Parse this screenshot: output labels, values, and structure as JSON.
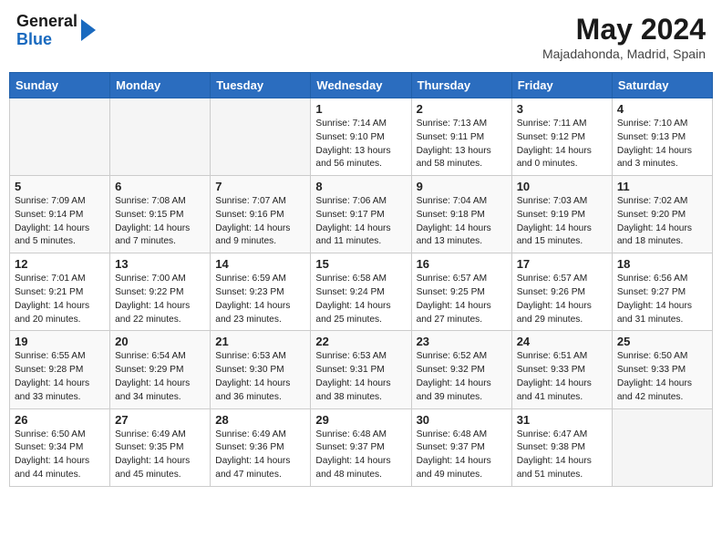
{
  "header": {
    "logo_general": "General",
    "logo_blue": "Blue",
    "month_title": "May 2024",
    "location": "Majadahonda, Madrid, Spain"
  },
  "days_of_week": [
    "Sunday",
    "Monday",
    "Tuesday",
    "Wednesday",
    "Thursday",
    "Friday",
    "Saturday"
  ],
  "weeks": [
    [
      {
        "day": "",
        "info": ""
      },
      {
        "day": "",
        "info": ""
      },
      {
        "day": "",
        "info": ""
      },
      {
        "day": "1",
        "info": "Sunrise: 7:14 AM\nSunset: 9:10 PM\nDaylight: 13 hours\nand 56 minutes."
      },
      {
        "day": "2",
        "info": "Sunrise: 7:13 AM\nSunset: 9:11 PM\nDaylight: 13 hours\nand 58 minutes."
      },
      {
        "day": "3",
        "info": "Sunrise: 7:11 AM\nSunset: 9:12 PM\nDaylight: 14 hours\nand 0 minutes."
      },
      {
        "day": "4",
        "info": "Sunrise: 7:10 AM\nSunset: 9:13 PM\nDaylight: 14 hours\nand 3 minutes."
      }
    ],
    [
      {
        "day": "5",
        "info": "Sunrise: 7:09 AM\nSunset: 9:14 PM\nDaylight: 14 hours\nand 5 minutes."
      },
      {
        "day": "6",
        "info": "Sunrise: 7:08 AM\nSunset: 9:15 PM\nDaylight: 14 hours\nand 7 minutes."
      },
      {
        "day": "7",
        "info": "Sunrise: 7:07 AM\nSunset: 9:16 PM\nDaylight: 14 hours\nand 9 minutes."
      },
      {
        "day": "8",
        "info": "Sunrise: 7:06 AM\nSunset: 9:17 PM\nDaylight: 14 hours\nand 11 minutes."
      },
      {
        "day": "9",
        "info": "Sunrise: 7:04 AM\nSunset: 9:18 PM\nDaylight: 14 hours\nand 13 minutes."
      },
      {
        "day": "10",
        "info": "Sunrise: 7:03 AM\nSunset: 9:19 PM\nDaylight: 14 hours\nand 15 minutes."
      },
      {
        "day": "11",
        "info": "Sunrise: 7:02 AM\nSunset: 9:20 PM\nDaylight: 14 hours\nand 18 minutes."
      }
    ],
    [
      {
        "day": "12",
        "info": "Sunrise: 7:01 AM\nSunset: 9:21 PM\nDaylight: 14 hours\nand 20 minutes."
      },
      {
        "day": "13",
        "info": "Sunrise: 7:00 AM\nSunset: 9:22 PM\nDaylight: 14 hours\nand 22 minutes."
      },
      {
        "day": "14",
        "info": "Sunrise: 6:59 AM\nSunset: 9:23 PM\nDaylight: 14 hours\nand 23 minutes."
      },
      {
        "day": "15",
        "info": "Sunrise: 6:58 AM\nSunset: 9:24 PM\nDaylight: 14 hours\nand 25 minutes."
      },
      {
        "day": "16",
        "info": "Sunrise: 6:57 AM\nSunset: 9:25 PM\nDaylight: 14 hours\nand 27 minutes."
      },
      {
        "day": "17",
        "info": "Sunrise: 6:57 AM\nSunset: 9:26 PM\nDaylight: 14 hours\nand 29 minutes."
      },
      {
        "day": "18",
        "info": "Sunrise: 6:56 AM\nSunset: 9:27 PM\nDaylight: 14 hours\nand 31 minutes."
      }
    ],
    [
      {
        "day": "19",
        "info": "Sunrise: 6:55 AM\nSunset: 9:28 PM\nDaylight: 14 hours\nand 33 minutes."
      },
      {
        "day": "20",
        "info": "Sunrise: 6:54 AM\nSunset: 9:29 PM\nDaylight: 14 hours\nand 34 minutes."
      },
      {
        "day": "21",
        "info": "Sunrise: 6:53 AM\nSunset: 9:30 PM\nDaylight: 14 hours\nand 36 minutes."
      },
      {
        "day": "22",
        "info": "Sunrise: 6:53 AM\nSunset: 9:31 PM\nDaylight: 14 hours\nand 38 minutes."
      },
      {
        "day": "23",
        "info": "Sunrise: 6:52 AM\nSunset: 9:32 PM\nDaylight: 14 hours\nand 39 minutes."
      },
      {
        "day": "24",
        "info": "Sunrise: 6:51 AM\nSunset: 9:33 PM\nDaylight: 14 hours\nand 41 minutes."
      },
      {
        "day": "25",
        "info": "Sunrise: 6:50 AM\nSunset: 9:33 PM\nDaylight: 14 hours\nand 42 minutes."
      }
    ],
    [
      {
        "day": "26",
        "info": "Sunrise: 6:50 AM\nSunset: 9:34 PM\nDaylight: 14 hours\nand 44 minutes."
      },
      {
        "day": "27",
        "info": "Sunrise: 6:49 AM\nSunset: 9:35 PM\nDaylight: 14 hours\nand 45 minutes."
      },
      {
        "day": "28",
        "info": "Sunrise: 6:49 AM\nSunset: 9:36 PM\nDaylight: 14 hours\nand 47 minutes."
      },
      {
        "day": "29",
        "info": "Sunrise: 6:48 AM\nSunset: 9:37 PM\nDaylight: 14 hours\nand 48 minutes."
      },
      {
        "day": "30",
        "info": "Sunrise: 6:48 AM\nSunset: 9:37 PM\nDaylight: 14 hours\nand 49 minutes."
      },
      {
        "day": "31",
        "info": "Sunrise: 6:47 AM\nSunset: 9:38 PM\nDaylight: 14 hours\nand 51 minutes."
      },
      {
        "day": "",
        "info": ""
      }
    ]
  ]
}
